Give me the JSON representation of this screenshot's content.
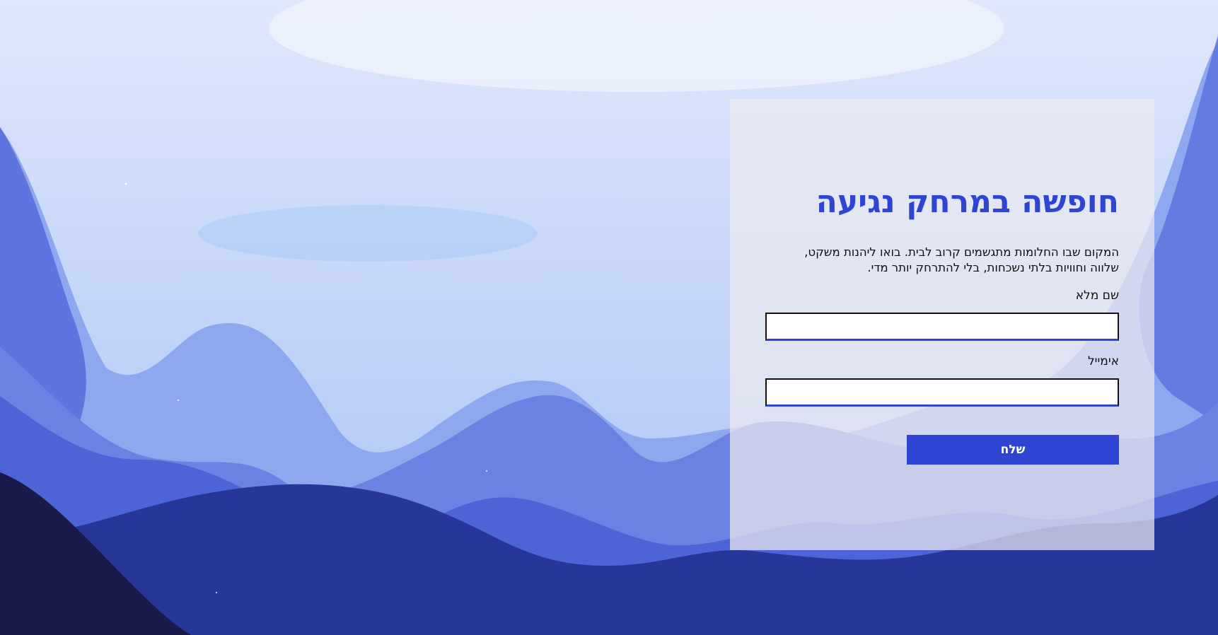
{
  "hero": {
    "title": "חופשה במרחק נגיעה",
    "description": "המקום שבו החלומות מתגשמים קרוב לבית. בואו ליהנות משקט, שלווה וחוויות בלתי נשכחות, בלי להתרחק יותר מדי."
  },
  "form": {
    "name_label": "שם מלא",
    "name_value": "",
    "email_label": "אימייל",
    "email_value": "",
    "submit_label": "שלח"
  },
  "colors": {
    "accent": "#2d45d2",
    "sky": "#c9d8f8",
    "mountain_light": "#8faaf0",
    "mountain_mid": "#4a62d6",
    "mountain_dark": "#24349a",
    "foreground_dark": "#1a1b4a",
    "panel": "#ecebf0"
  }
}
